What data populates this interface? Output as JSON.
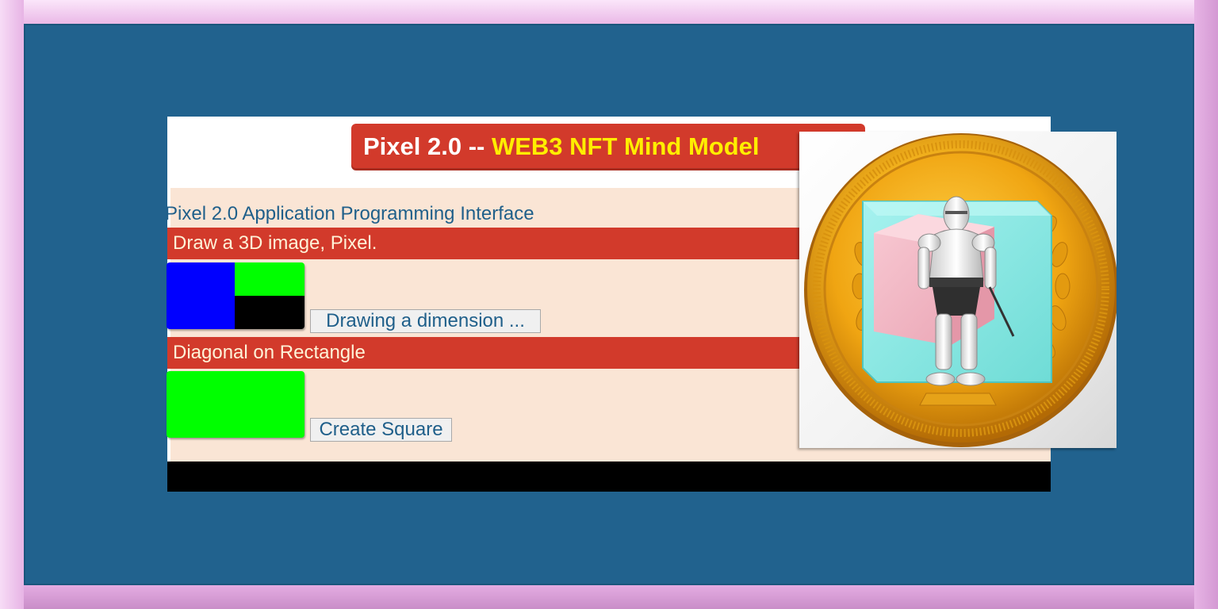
{
  "title": {
    "prefix": "Pixel 2.0 -- ",
    "highlight": "WEB3 NFT Mind Model"
  },
  "api": {
    "heading": "Pixel 2.0 Application Programming Interface",
    "sections": [
      {
        "header": "Draw a 3D image, Pixel.",
        "button_label": "Drawing a dimension ...",
        "canvas_colors": [
          "#0000ff",
          "#00ff00",
          "#000000"
        ]
      },
      {
        "header": "Diagonal on Rectangle",
        "button_label": "Create Square",
        "canvas_colors": [
          "#00ff00"
        ]
      }
    ]
  },
  "colors": {
    "frame": "#e9b8e6",
    "stage": "#21628e",
    "accent_red": "#d23a2b",
    "title_highlight": "#ffee00",
    "content_bg": "#fae5d5",
    "link_text": "#1f5f8a"
  },
  "image": {
    "icon": "gold-coin-knight-icon"
  }
}
